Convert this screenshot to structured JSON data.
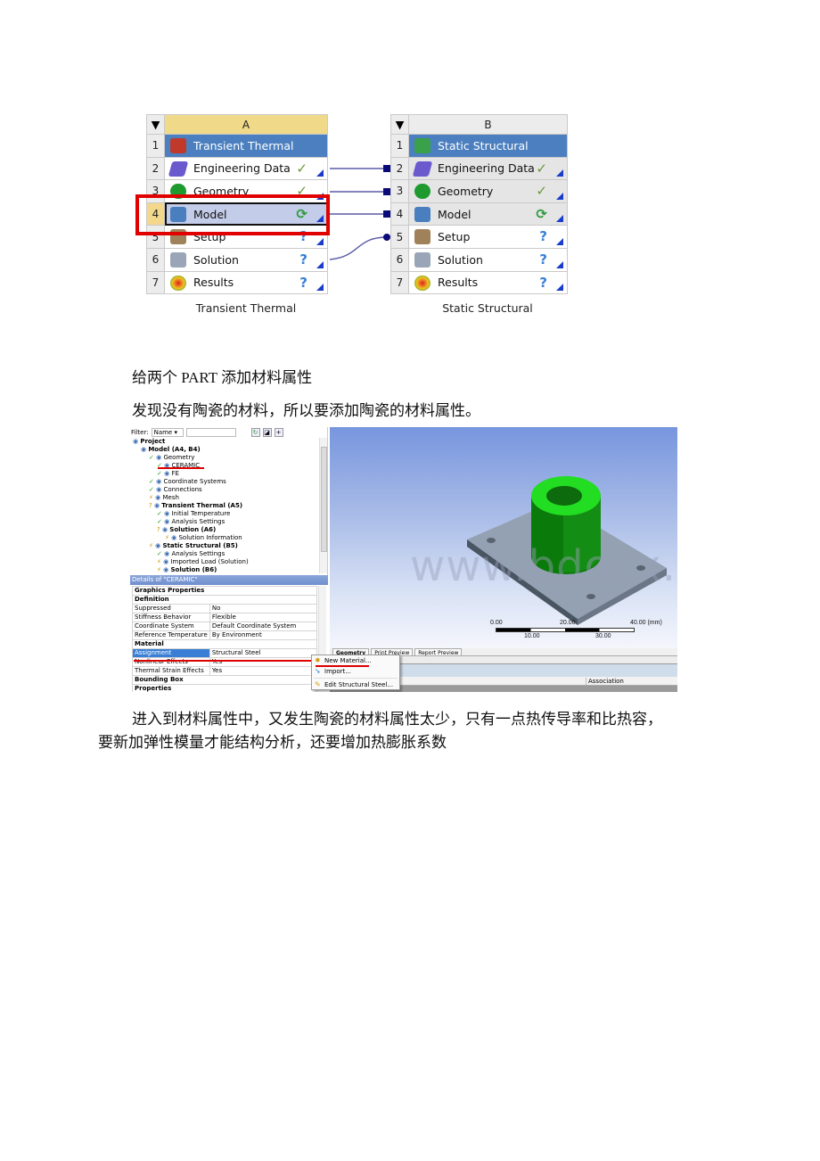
{
  "schematic": {
    "system_a": {
      "column": "A",
      "label": "Transient Thermal",
      "rows": [
        {
          "num": "1",
          "name": "Transient Thermal",
          "icon": "transient-thermal-icon",
          "status": ""
        },
        {
          "num": "2",
          "name": "Engineering Data",
          "icon": "engineering-data-icon",
          "status": "✓"
        },
        {
          "num": "3",
          "name": "Geometry",
          "icon": "geometry-dm-icon",
          "status": "✓"
        },
        {
          "num": "4",
          "name": "Model",
          "icon": "model-icon",
          "status": "⟳"
        },
        {
          "num": "5",
          "name": "Setup",
          "icon": "setup-icon",
          "status": "?"
        },
        {
          "num": "6",
          "name": "Solution",
          "icon": "solution-icon",
          "status": "?"
        },
        {
          "num": "7",
          "name": "Results",
          "icon": "results-icon",
          "status": "?"
        }
      ]
    },
    "system_b": {
      "column": "B",
      "label": "Static Structural",
      "rows": [
        {
          "num": "1",
          "name": "Static Structural",
          "icon": "static-structural-icon",
          "status": ""
        },
        {
          "num": "2",
          "name": "Engineering Data",
          "icon": "engineering-data-icon",
          "status": "✓"
        },
        {
          "num": "3",
          "name": "Geometry",
          "icon": "geometry-dm-icon",
          "status": "✓"
        },
        {
          "num": "4",
          "name": "Model",
          "icon": "model-icon",
          "status": "⟳"
        },
        {
          "num": "5",
          "name": "Setup",
          "icon": "setup-icon",
          "status": "?"
        },
        {
          "num": "6",
          "name": "Solution",
          "icon": "solution-icon",
          "status": "?"
        },
        {
          "num": "7",
          "name": "Results",
          "icon": "results-icon",
          "status": "?"
        }
      ]
    },
    "colors": {
      "title_bg": "#4b7fbf",
      "header_bg": "#f1d98a",
      "highlight_box": "#e00000",
      "link_line": "#5a5aa8"
    }
  },
  "paragraphs": {
    "p1": "给两个 PART 添加材料属性",
    "p2": "发现没有陶瓷的材料，所以要添加陶瓷的材料属性。",
    "p3_line1": "进入到材料属性中，又发生陶瓷的材料属性太少，只有一点热传导率和比热容，",
    "p3_line2": "要新加弹性模量才能结构分析，还要增加热膨胀系数"
  },
  "mechanical": {
    "filter": {
      "label": "Filter:",
      "value": "Name"
    },
    "tree": [
      {
        "indent": 0,
        "text": "Project",
        "bold": true,
        "mark": ""
      },
      {
        "indent": 1,
        "text": "Model (A4, B4)",
        "bold": true,
        "mark": ""
      },
      {
        "indent": 2,
        "text": "Geometry",
        "bold": false,
        "mark": "✓"
      },
      {
        "indent": 3,
        "text": "CERAMIC",
        "bold": false,
        "mark": "✓"
      },
      {
        "indent": 3,
        "text": "FE",
        "bold": false,
        "mark": "✓"
      },
      {
        "indent": 2,
        "text": "Coordinate Systems",
        "bold": false,
        "mark": "✓"
      },
      {
        "indent": 2,
        "text": "Connections",
        "bold": false,
        "mark": "✓"
      },
      {
        "indent": 2,
        "text": "Mesh",
        "bold": false,
        "mark": "⚡"
      },
      {
        "indent": 2,
        "text": "Transient Thermal (A5)",
        "bold": true,
        "mark": "?"
      },
      {
        "indent": 3,
        "text": "Initial Temperature",
        "bold": false,
        "mark": "✓"
      },
      {
        "indent": 3,
        "text": "Analysis Settings",
        "bold": false,
        "mark": "✓"
      },
      {
        "indent": 3,
        "text": "Solution (A6)",
        "bold": true,
        "mark": "?"
      },
      {
        "indent": 4,
        "text": "Solution Information",
        "bold": false,
        "mark": "⚡"
      },
      {
        "indent": 2,
        "text": "Static Structural (B5)",
        "bold": true,
        "mark": "⚡"
      },
      {
        "indent": 3,
        "text": "Analysis Settings",
        "bold": false,
        "mark": "✓"
      },
      {
        "indent": 3,
        "text": "Imported Load (Solution)",
        "bold": false,
        "mark": "⚡"
      },
      {
        "indent": 3,
        "text": "Solution (B6)",
        "bold": true,
        "mark": "⚡"
      }
    ],
    "details": {
      "title": "Details of \"CERAMIC\"",
      "rows": [
        {
          "type": "group",
          "key": "Graphics Properties",
          "value": ""
        },
        {
          "type": "group",
          "key": "Definition",
          "value": ""
        },
        {
          "type": "prop",
          "key": "Suppressed",
          "value": "No"
        },
        {
          "type": "prop",
          "key": "Stiffness Behavior",
          "value": "Flexible"
        },
        {
          "type": "prop",
          "key": "Coordinate System",
          "value": "Default Coordinate System"
        },
        {
          "type": "prop",
          "key": "Reference Temperature",
          "value": "By Environment"
        },
        {
          "type": "group",
          "key": "Material",
          "value": ""
        },
        {
          "type": "prop-hl",
          "key": "Assignment",
          "value": "Structural Steel"
        },
        {
          "type": "prop",
          "key": "Nonlinear Effects",
          "value": "Yes"
        },
        {
          "type": "prop",
          "key": "Thermal Strain Effects",
          "value": "Yes"
        },
        {
          "type": "group",
          "key": "Bounding Box",
          "value": ""
        },
        {
          "type": "group",
          "key": "Properties",
          "value": ""
        }
      ]
    },
    "context_menu": [
      {
        "label": "New Material...",
        "icon": "new-material-icon"
      },
      {
        "label": "Import...",
        "icon": "import-icon"
      },
      {
        "label": "Edit Structural Steel...",
        "icon": "edit-material-icon"
      }
    ],
    "viewport": {
      "watermark": "www.bdocx.com",
      "scale_top": [
        "0.00",
        "20.00",
        "40.00 (mm)"
      ],
      "scale_bottom": [
        "10.00",
        "30.00"
      ]
    },
    "tabs": [
      "Geometry",
      "Print Preview",
      "Report Preview"
    ],
    "association_header": "Association"
  }
}
